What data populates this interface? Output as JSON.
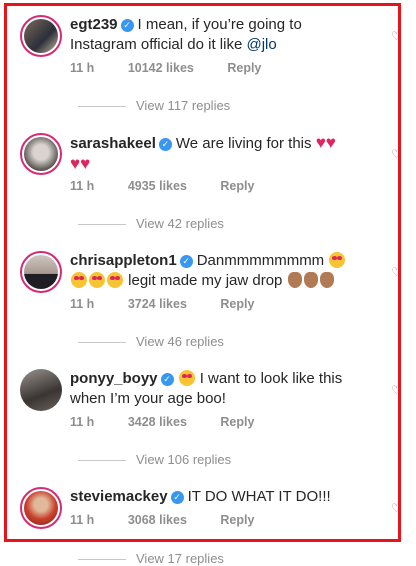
{
  "comments": [
    {
      "username": "egt239",
      "text": "I mean, if you’re going to Instagram official do it like ",
      "mention": "@jlo",
      "time": "11 h",
      "likes": "10142 likes",
      "reply": "Reply",
      "view_replies": "View 117 replies"
    },
    {
      "username": "sarashakeel",
      "text": "We are living for this ",
      "time": "11 h",
      "likes": "4935 likes",
      "reply": "Reply",
      "view_replies": "View 42 replies"
    },
    {
      "username": "chrisappleton1",
      "text": "Danmmmmmmmm ",
      "text2": " legit made my jaw drop ",
      "time": "11 h",
      "likes": "3724 likes",
      "reply": "Reply",
      "view_replies": "View 46 replies"
    },
    {
      "username": "ponyy_boyy",
      "text": " I want to look like this when I’m your age boo!",
      "time": "11 h",
      "likes": "3428 likes",
      "reply": "Reply",
      "view_replies": "View 106 replies"
    },
    {
      "username": "steviemackey",
      "text": "IT DO WHAT IT DO!!!",
      "time": "11 h",
      "likes": "3068 likes",
      "reply": "Reply",
      "view_replies": "View 17 replies"
    }
  ],
  "icons": {
    "verified": "verified-badge-icon",
    "like": "heart-outline-icon"
  },
  "colors": {
    "highlight_border": "#e8141b",
    "verified": "#3897f0",
    "secondary_text": "#8e8e8e"
  }
}
